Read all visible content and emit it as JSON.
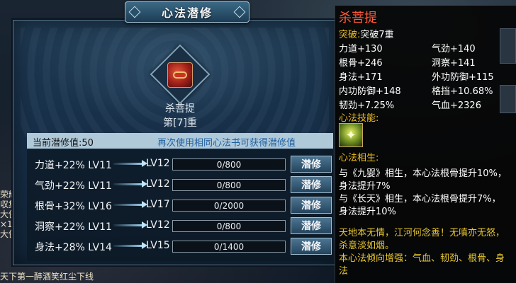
{
  "background": {
    "chat_fragments": [
      "荣耀",
      "収集",
      "大侠",
      "×1",
      "大侠"
    ],
    "bottom_line": "天下第一醉酒笑红尘下线"
  },
  "panel": {
    "title": "心法潜修",
    "book": {
      "name": "杀菩提",
      "tier": "第[7]重",
      "icon": "red-scroll-book-icon"
    },
    "current_label": "当前潜修值:50",
    "tip": "再次使用相同心法书可获得潜修值",
    "rows": [
      {
        "current": "力道+22% LV11",
        "next": "LV12",
        "progress": "0/800",
        "fraction": 0,
        "button": "潜修"
      },
      {
        "current": "气劲+22% LV11",
        "next": "LV12",
        "progress": "0/800",
        "fraction": 0,
        "button": "潜修"
      },
      {
        "current": "根骨+32% LV16",
        "next": "LV17",
        "progress": "0/2000",
        "fraction": 0,
        "button": "潜修"
      },
      {
        "current": "洞察+22% LV11",
        "next": "LV12",
        "progress": "0/800",
        "fraction": 0,
        "button": "潜修"
      },
      {
        "current": "身法+28% LV14",
        "next": "LV15",
        "progress": "0/1400",
        "fraction": 0,
        "button": "潜修"
      }
    ]
  },
  "tooltip": {
    "name": "杀菩提",
    "breakthrough_key": "突破:",
    "breakthrough_val": "突破7重",
    "stats": [
      [
        "力道+130",
        "气劲+140"
      ],
      [
        "根骨+246",
        "洞察+141"
      ],
      [
        "身法+171",
        "外功防御+115"
      ],
      [
        "内功防御+148",
        "格挡+10.68%"
      ],
      [
        "韧劲+7.25%",
        "气血+2326"
      ]
    ],
    "skill_label": "心法技能:",
    "skill_icon": "green-skill-icon",
    "synergy_label": "心法相生:",
    "synergy": [
      "与《九婴》相生，本心法根骨提升10%，",
      "身法提升7%",
      "与《长天》相生，本心法根骨提升7%，",
      "身法提升10%"
    ],
    "lore": [
      "天地本无情，江河何念善！无嗔亦无怒，",
      "杀意淡如烟。",
      "本心法倾向增强：气血、韧劲、根骨、身",
      "法"
    ]
  }
}
